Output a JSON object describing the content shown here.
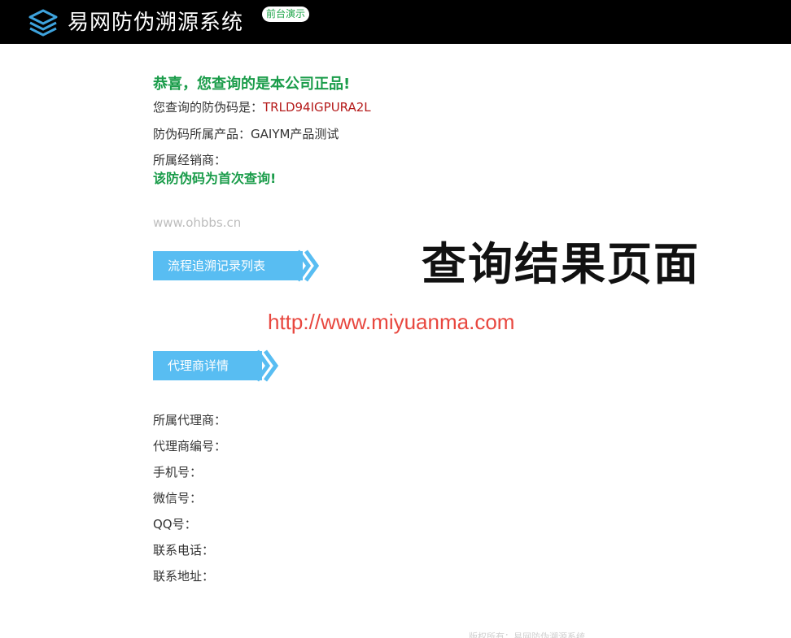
{
  "header": {
    "title": "易网防伪溯源系统",
    "badge": "前台演示"
  },
  "result": {
    "success_title": "恭喜，您查询的是本公司正品!",
    "code_label": "您查询的防伪码是：",
    "code_value": "TRLD94IGPURA2L",
    "product_label": "防伪码所属产品：",
    "product_value": "GAIYM产品测试",
    "dealer_label": "所属经销商：",
    "first_query": "该防伪码为首次查询!",
    "watermark": "www.ohbbs.cn"
  },
  "sections": {
    "trace_records": "流程追溯记录列表",
    "agent_details": "代理商详情"
  },
  "agent": {
    "agent_label": "所属代理商：",
    "agent_no_label": "代理商编号：",
    "phone_label": "手机号：",
    "wechat_label": "微信号：",
    "qq_label": "QQ号：",
    "tel_label": "联系电话：",
    "address_label": "联系地址："
  },
  "overlay": {
    "title": "查询结果页面",
    "url": "http://www.miyuanma.com"
  },
  "footer": {
    "text": "版权所有：易网防伪溯源系统"
  },
  "colors": {
    "header_bg": "#000000",
    "success_green": "#1a9c4a",
    "code_red": "#b51b1b",
    "section_blue": "#58bdf2",
    "url_red": "#e8473f"
  }
}
